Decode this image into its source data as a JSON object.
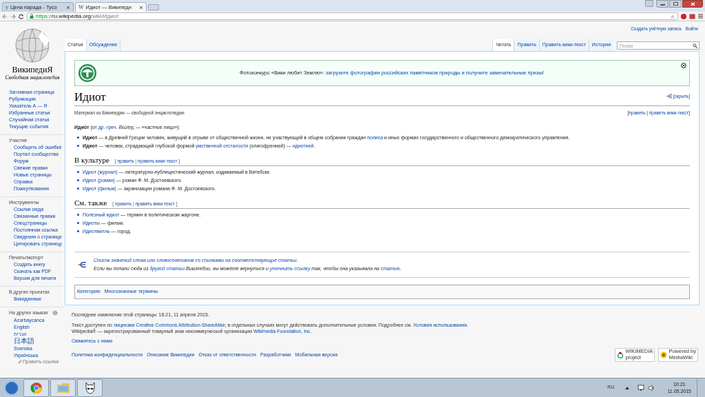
{
  "browser": {
    "tabs": [
      {
        "title": "Цена парада - Тусо",
        "favicon": "y",
        "selected": false
      },
      {
        "title": "Идиот — Википеди",
        "favicon": "W",
        "selected": true
      }
    ],
    "url": {
      "scheme": "https://",
      "host": "ru.wikipedia.org",
      "path": "/wiki/Идиот"
    }
  },
  "personal_links": [
    "Создать учётную запись",
    "Войти"
  ],
  "logo": {
    "title": "ВикипедиЯ",
    "subtitle": "Свободная энциклопедия"
  },
  "sidebar": [
    {
      "items": [
        "Заглавная страница",
        "Рубрикация",
        "Указатель А — Я",
        "Избранные статьи",
        "Случайная статья",
        "Текущие события"
      ]
    },
    {
      "heading": "Участие",
      "items": [
        "Сообщить об ошибке",
        "Портал сообщества",
        "Форум",
        "Свежие правки",
        "Новые страницы",
        "Справка",
        "Пожертвования"
      ]
    },
    {
      "heading": "Инструменты",
      "items": [
        "Ссылки сюда",
        "Связанные правки",
        "Спецстраницы",
        "Постоянная ссылка",
        "Сведения о странице",
        "Цитировать страницу"
      ]
    },
    {
      "heading": "Печать/экспорт",
      "items": [
        "Создать книгу",
        "Скачать как PDF",
        "Версия для печати"
      ]
    },
    {
      "heading": "В других проектах",
      "items": [
        "Викиданные"
      ]
    },
    {
      "heading": "На других языках",
      "languages": [
        {
          "name": "Azərbaycanca",
          "kind": "latin"
        },
        {
          "name": "English",
          "kind": "latin"
        },
        {
          "name": "עברית",
          "kind": "latin"
        },
        {
          "name": "日本語",
          "kind": "cjk"
        },
        {
          "name": "Svenska",
          "kind": "latin"
        },
        {
          "name": "Українська",
          "kind": "latin"
        }
      ],
      "edit_link": "Править ссылки"
    }
  ],
  "page_tabs": [
    {
      "label": "Статья",
      "selected": true
    },
    {
      "label": "Обсуждение",
      "selected": false
    }
  ],
  "view_tabs": [
    {
      "label": "Читать",
      "selected": true
    },
    {
      "label": "Править",
      "selected": false
    },
    {
      "label": "Править вики-текст",
      "selected": false
    },
    {
      "label": "История",
      "selected": false
    }
  ],
  "search": {
    "placeholder": "Поиск"
  },
  "banner": [
    {
      "kind": "text",
      "t": "Фотоконкурс «Вики любит Землю»: "
    },
    {
      "kind": "link",
      "t": "загрузите фотографии российских памятников природы и получите замечательные призы"
    },
    {
      "kind": "text",
      "t": "!"
    }
  ],
  "article": {
    "title": "Идиот",
    "hide": [
      {
        "kind": "link",
        "t": "[скрыть]"
      }
    ],
    "tagline": "Материал из Википедии — свободной энциклопедии",
    "edit": [
      {
        "kind": "text",
        "t": "["
      },
      {
        "kind": "link",
        "t": "править"
      },
      {
        "kind": "text",
        "t": " | "
      },
      {
        "kind": "link",
        "t": "править вики-текст"
      },
      {
        "kind": "text",
        "t": "]"
      }
    ],
    "intro": [
      {
        "kind": "bold",
        "t": "Идио́т"
      },
      {
        "kind": "text",
        "t": " (от "
      },
      {
        "kind": "link",
        "t": "др.-греч."
      },
      {
        "kind": "text",
        "t": " ἰδιώτης — «частное лицо»):"
      }
    ],
    "bullets": [
      [
        {
          "kind": "bold",
          "t": "Идиот"
        },
        {
          "kind": "text",
          "t": " — в Древней Греции человек, живущий в отрыве от общественной жизни, не участвующий в общем собрании граждан "
        },
        {
          "kind": "link",
          "t": "полиса"
        },
        {
          "kind": "text",
          "t": " и иных формах государственного и общественного демократического управления."
        }
      ],
      [
        {
          "kind": "bold",
          "t": "Идиот"
        },
        {
          "kind": "text",
          "t": " — человек, страдающий глубокой формой "
        },
        {
          "kind": "link",
          "t": "умственной отсталости"
        },
        {
          "kind": "text",
          "t": " (олигофренией) — "
        },
        {
          "kind": "link",
          "t": "идиотией"
        },
        {
          "kind": "text",
          "t": "."
        }
      ]
    ],
    "sections": [
      {
        "heading": "В культуре",
        "edit": [
          {
            "kind": "text",
            "t": "[ "
          },
          {
            "kind": "link",
            "t": "править"
          },
          {
            "kind": "text",
            "t": " | "
          },
          {
            "kind": "link",
            "t": "править вики-текст"
          },
          {
            "kind": "text",
            "t": " ]"
          }
        ],
        "items": [
          [
            {
              "kind": "link",
              "t": "Идиот (журнал)"
            },
            {
              "kind": "text",
              "t": " — литературно-публицистический журнал, издаваемый в Витебске."
            }
          ],
          [
            {
              "kind": "link",
              "t": "Идиот (роман)"
            },
            {
              "kind": "text",
              "t": " — роман Ф. М. Достоевского."
            }
          ],
          [
            {
              "kind": "link",
              "t": "Идиот (фильм)"
            },
            {
              "kind": "text",
              "t": " — экранизации романа Ф. М. Достоевского."
            }
          ]
        ]
      },
      {
        "heading": "См. также",
        "edit": [
          {
            "kind": "text",
            "t": "[ "
          },
          {
            "kind": "link",
            "t": "править"
          },
          {
            "kind": "text",
            "t": " | "
          },
          {
            "kind": "link",
            "t": "править вики-текст"
          },
          {
            "kind": "text",
            "t": " ]"
          }
        ],
        "items": [
          [
            {
              "kind": "link",
              "t": "Полезный идиот"
            },
            {
              "kind": "text",
              "t": " — термин в политическом жаргоне."
            }
          ],
          [
            {
              "kind": "link",
              "t": "Идиоты"
            },
            {
              "kind": "text",
              "t": " — фильм."
            }
          ],
          [
            {
              "kind": "link",
              "t": "Идиотвилль"
            },
            {
              "kind": "text",
              "t": " — город."
            }
          ]
        ]
      }
    ],
    "disambig": [
      [
        {
          "kind": "link",
          "t": "Список значений слова или словосочетания со ссылками на соответствующие статьи."
        }
      ],
      [
        {
          "kind": "text",
          "t": "Если вы попали сюда из "
        },
        {
          "kind": "link",
          "t": "другой статьи"
        },
        {
          "kind": "text",
          "t": " Википедии, вы можете вернуться и "
        },
        {
          "kind": "link",
          "t": "уточнить ссылку"
        },
        {
          "kind": "text",
          "t": " так, чтобы она указывала на "
        },
        {
          "kind": "link",
          "t": "статью"
        },
        {
          "kind": "text",
          "t": "."
        }
      ]
    ],
    "categories": {
      "label": "Категория:",
      "items": [
        "Многозначные термины"
      ]
    }
  },
  "footer": {
    "last_modified": "Последнее изменение этой страницы: 18:21, 11 апреля 2015.",
    "license": [
      [
        {
          "kind": "text",
          "t": "Текст доступен по "
        },
        {
          "kind": "link",
          "t": "лицензии Creative Commons Attribution-ShareAlike"
        },
        {
          "kind": "text",
          "t": "; в отдельных случаях могут действовать дополнительные условия. Подробнее см. "
        },
        {
          "kind": "link",
          "t": "Условия использования"
        },
        {
          "kind": "text",
          "t": "."
        }
      ],
      [
        {
          "kind": "text",
          "t": "Wikipedia® — зарегистрированный товарный знак некоммерческой организации "
        },
        {
          "kind": "link",
          "t": "Wikimedia Foundation, Inc."
        }
      ]
    ],
    "contact": "Свяжитесь с нами",
    "links": [
      "Политика конфиденциальности",
      "Описание Википедии",
      "Отказ от ответственности",
      "Разработчики",
      "Мобильная версия"
    ],
    "badges": [
      {
        "kind": "wikimedia",
        "line1": "WIKIMEDIA",
        "line2": "project"
      },
      {
        "kind": "mediawiki",
        "line1": "Powered by",
        "line2": "MediaWiki"
      }
    ]
  },
  "taskbar": {
    "language": "RU",
    "time": "10:21",
    "date": "11.05.2015"
  }
}
